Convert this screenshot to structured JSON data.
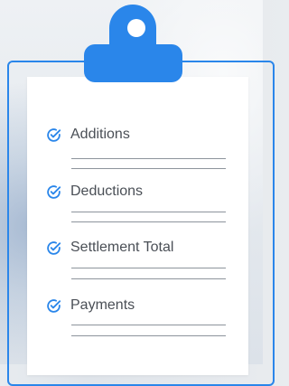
{
  "checklist": {
    "items": [
      {
        "label": "Additions"
      },
      {
        "label": "Deductions"
      },
      {
        "label": "Settlement Total"
      },
      {
        "label": "Payments"
      }
    ]
  },
  "colors": {
    "accent": "#2a86ea",
    "text": "#4a4f56",
    "line": "#8d949c",
    "paper": "#ffffff"
  },
  "icons": {
    "item": "check-circle-icon",
    "clip_hole": "clip-hole-icon"
  }
}
